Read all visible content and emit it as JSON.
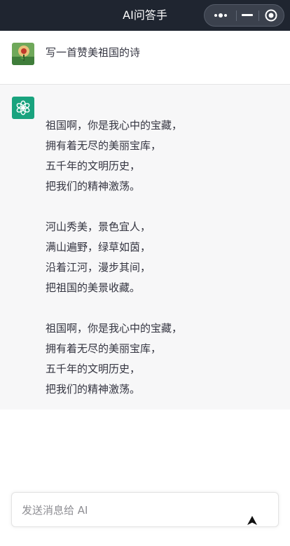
{
  "header": {
    "title": "AI问答手",
    "more_icon": "more-dots-icon",
    "minimize_icon": "minimize-icon",
    "close_icon": "target-close-icon"
  },
  "user_message": {
    "avatar_icon": "user-avatar-image",
    "text": "写一首赞美祖国的诗"
  },
  "assistant_message": {
    "avatar_icon": "openai-logo-icon",
    "avatar_color": "#19a37e",
    "stanzas": [
      [
        "祖国啊，你是我心中的宝藏，",
        "拥有着无尽的美丽宝库，",
        "五千年的文明历史，",
        "把我们的精神激荡。"
      ],
      [
        "河山秀美，景色宜人，",
        "满山遍野，绿草如茵，",
        "沿着江河，漫步其间，",
        "把祖国的美景收藏。"
      ],
      [
        "祖国啊，你是我心中的宝藏，",
        "拥有着无尽的美丽宝库，",
        "五千年的文明历史，",
        "把我们的精神激荡。"
      ]
    ]
  },
  "composer": {
    "placeholder": "发送消息给 AI",
    "value": "",
    "send_icon": "send-arrow-icon"
  },
  "colors": {
    "topbar": "#1f2530",
    "assistant_bg": "#f7f7f8",
    "text": "#343541"
  }
}
